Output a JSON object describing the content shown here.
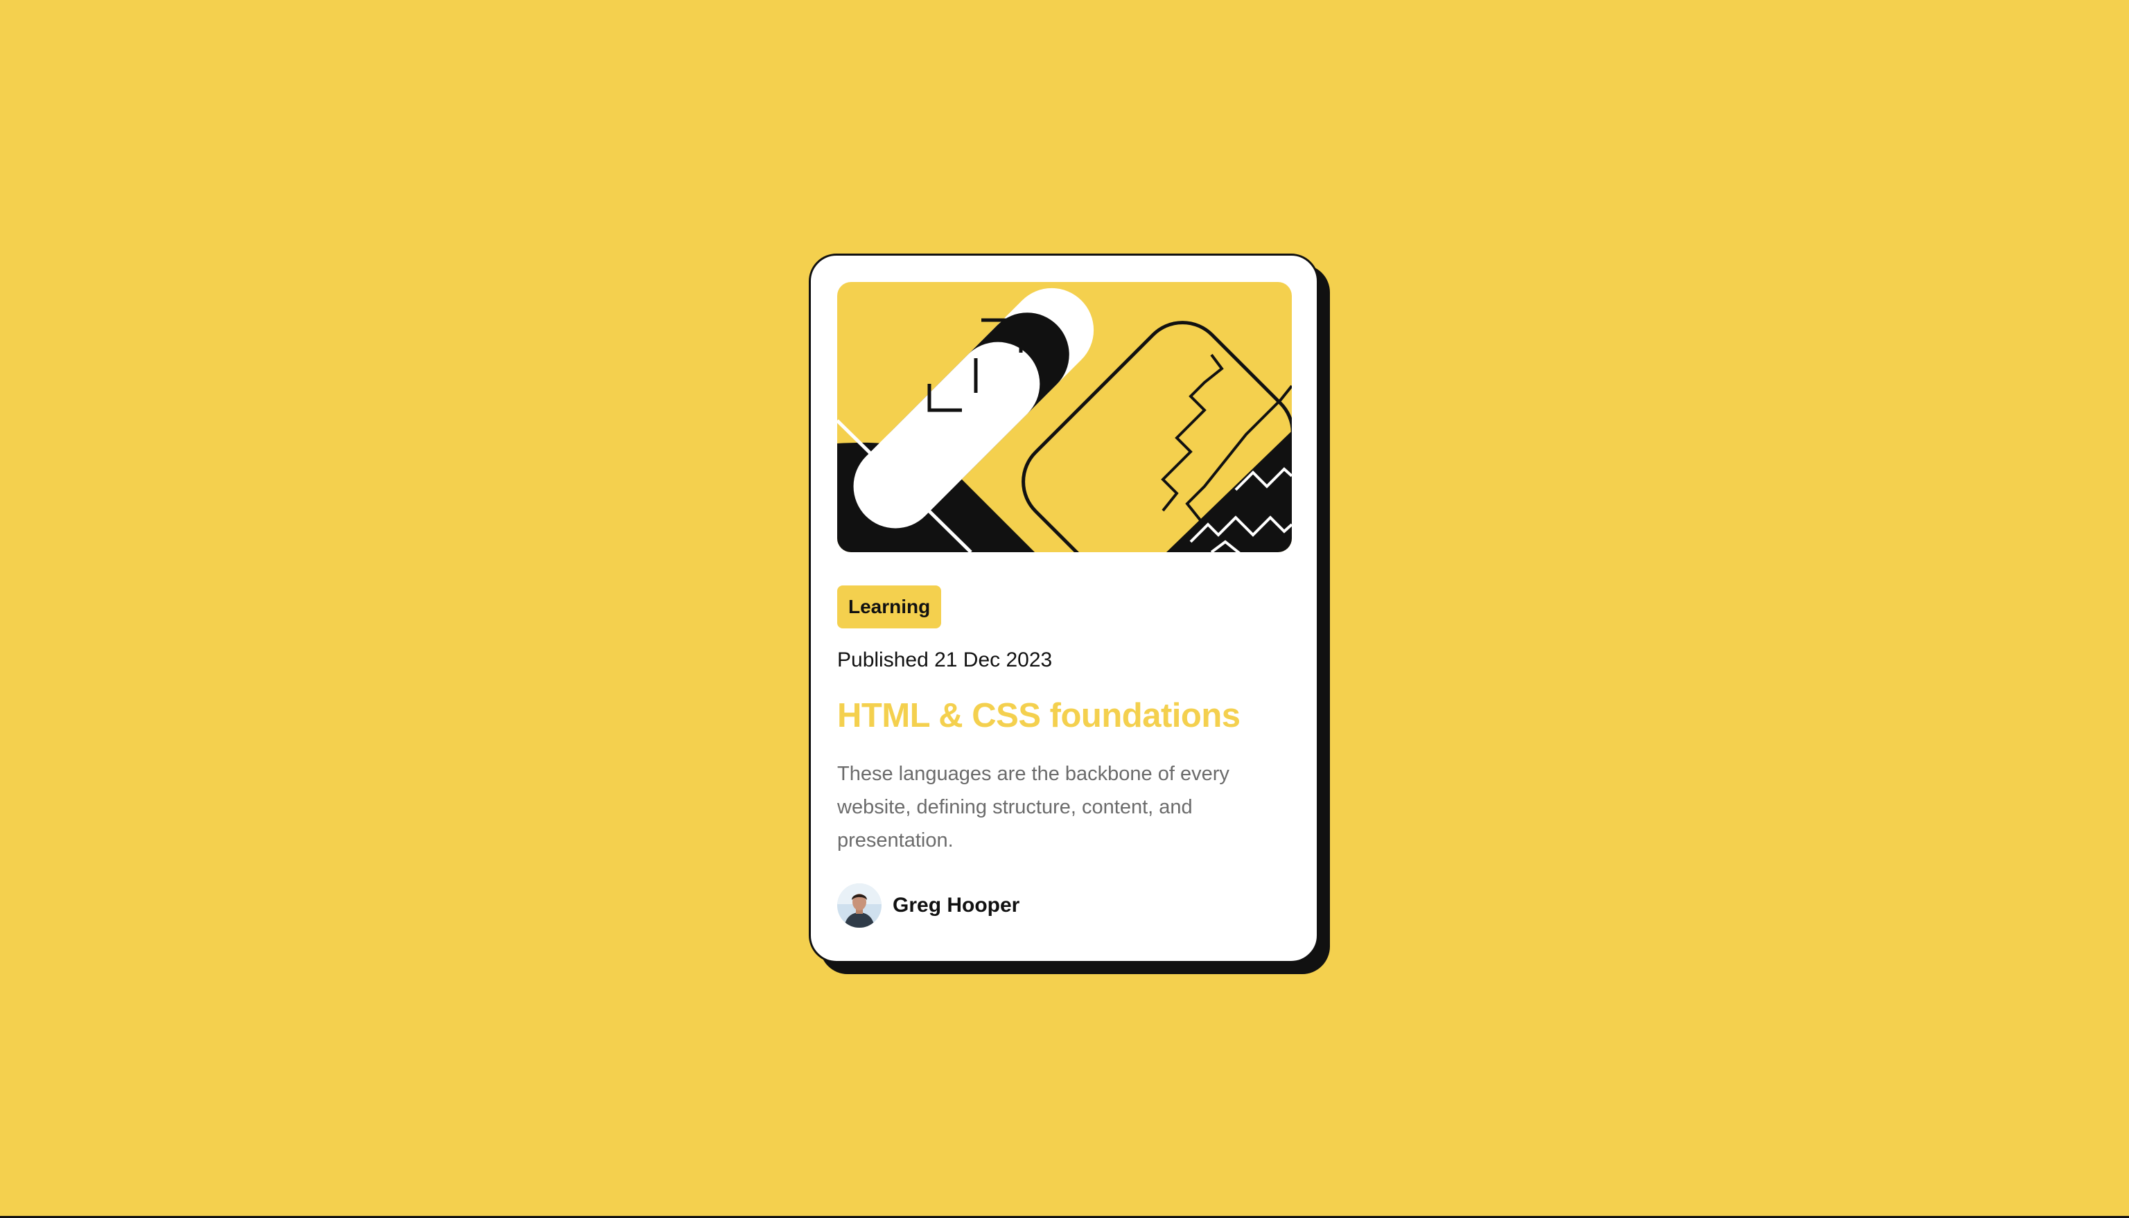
{
  "card": {
    "tag": "Learning",
    "published": "Published 21 Dec 2023",
    "title": "HTML & CSS foundations",
    "description": "These languages are the backbone of every website, defining structure, content, and presentation.",
    "author": {
      "name": "Greg Hooper"
    }
  },
  "colors": {
    "background": "#F4D04E",
    "card": "#FFFFFF",
    "ink": "#111111",
    "muted_text": "#6B6B6B",
    "accent": "#F4D04E"
  },
  "icons": {
    "illustration": "code-brackets-illustration",
    "avatar": "author-avatar-photo"
  }
}
